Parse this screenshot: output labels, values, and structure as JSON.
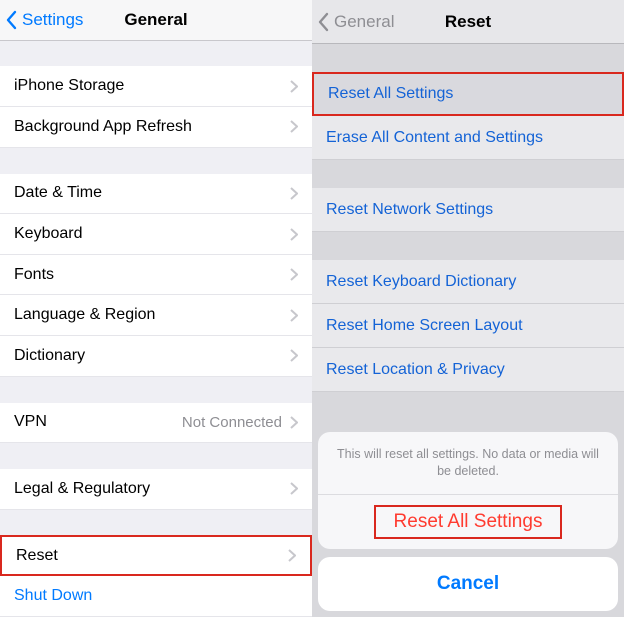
{
  "left": {
    "back": "Settings",
    "title": "General",
    "group1": [
      {
        "label": "iPhone Storage"
      },
      {
        "label": "Background App Refresh"
      }
    ],
    "group2": [
      {
        "label": "Date & Time"
      },
      {
        "label": "Keyboard"
      },
      {
        "label": "Fonts"
      },
      {
        "label": "Language & Region"
      },
      {
        "label": "Dictionary"
      }
    ],
    "group3": [
      {
        "label": "VPN",
        "value": "Not Connected"
      }
    ],
    "group4": [
      {
        "label": "Legal & Regulatory"
      }
    ],
    "group5": [
      {
        "label": "Reset",
        "highlight": true
      }
    ],
    "shutdown": "Shut Down"
  },
  "right": {
    "back": "General",
    "title": "Reset",
    "groupA": [
      {
        "label": "Reset All Settings",
        "highlight": true
      },
      {
        "label": "Erase All Content and Settings"
      }
    ],
    "groupB": [
      {
        "label": "Reset Network Settings"
      }
    ],
    "groupC": [
      {
        "label": "Reset Keyboard Dictionary"
      },
      {
        "label": "Reset Home Screen Layout"
      },
      {
        "label": "Reset Location & Privacy"
      }
    ],
    "sheet": {
      "message": "This will reset all settings. No data or media will be deleted.",
      "destructive": "Reset All Settings",
      "cancel": "Cancel"
    }
  }
}
